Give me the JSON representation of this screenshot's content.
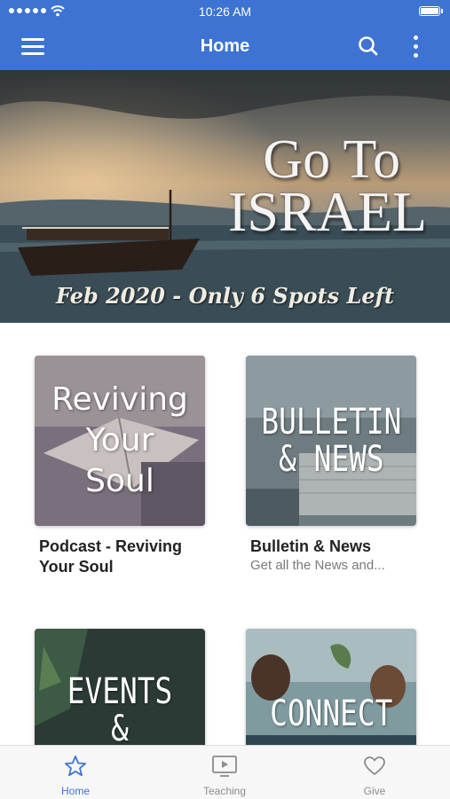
{
  "status_bar": {
    "time": "10:26 AM"
  },
  "nav": {
    "title": "Home",
    "menu_icon": "hamburger-menu-icon",
    "search_icon": "search-icon",
    "more_icon": "more-vertical-icon"
  },
  "banner": {
    "title_line1": "Go To",
    "title_line2": "ISRAEL",
    "subtitle": "Feb 2020 - Only 6 Spots Left"
  },
  "tiles": [
    {
      "image_text": [
        "Reviving",
        "Your",
        "Soul"
      ],
      "title": "Podcast - Reviving Your Soul",
      "subtitle": ""
    },
    {
      "image_text": [
        "BULLETIN",
        "& NEWS"
      ],
      "title": "Bulletin & News",
      "subtitle": "Get all the News and..."
    },
    {
      "image_text": [
        "EVENTS",
        "& GROUPS"
      ],
      "title": "",
      "subtitle": ""
    },
    {
      "image_text": [
        "CONNECT"
      ],
      "title": "",
      "subtitle": ""
    }
  ],
  "tab_bar": {
    "items": [
      {
        "label": "Home",
        "icon": "star-icon",
        "active": true
      },
      {
        "label": "Teaching",
        "icon": "tv-play-icon",
        "active": false
      },
      {
        "label": "Give",
        "icon": "heart-icon",
        "active": false
      }
    ]
  },
  "colors": {
    "brand_blue": "#3d73d3",
    "tab_inactive": "#8c8c8c"
  }
}
